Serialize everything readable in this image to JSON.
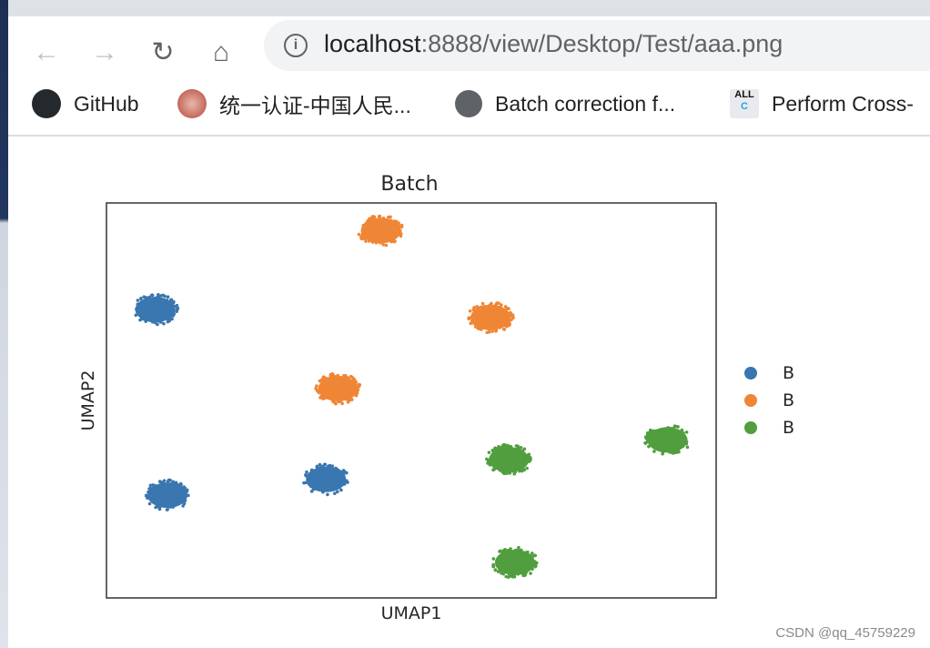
{
  "browser": {
    "url_host": "localhost",
    "url_rest": ":8888/view/Desktop/Test/aaa.png",
    "bookmarks": [
      {
        "label": "GitHub",
        "icon": "github-icon"
      },
      {
        "label": "统一认证-中国人民...",
        "icon": "university-seal-icon"
      },
      {
        "label": "Batch correction f...",
        "icon": "globe-icon"
      },
      {
        "label": "Perform Cross-",
        "icon": "allc-icon"
      }
    ]
  },
  "watermark": "CSDN @qq_45759229",
  "chart_data": {
    "type": "scatter",
    "title": "Batch",
    "xlabel": "UMAP1",
    "ylabel": "UMAP2",
    "xlim": [
      0,
      10
    ],
    "ylim": [
      0,
      10
    ],
    "grid": false,
    "ticks": false,
    "legend_placement": "right",
    "series": [
      {
        "name": "B",
        "color": "#3a76af",
        "clusters": [
          [
            0.8,
            7.3
          ],
          [
            1.0,
            2.6
          ],
          [
            3.6,
            3.0
          ]
        ]
      },
      {
        "name": "B",
        "color": "#ef8636",
        "clusters": [
          [
            4.5,
            9.3
          ],
          [
            6.3,
            7.1
          ],
          [
            3.8,
            5.3
          ]
        ]
      },
      {
        "name": "B",
        "color": "#519e3e",
        "clusters": [
          [
            6.6,
            3.5
          ],
          [
            9.2,
            4.0
          ],
          [
            6.7,
            0.9
          ]
        ]
      }
    ]
  }
}
